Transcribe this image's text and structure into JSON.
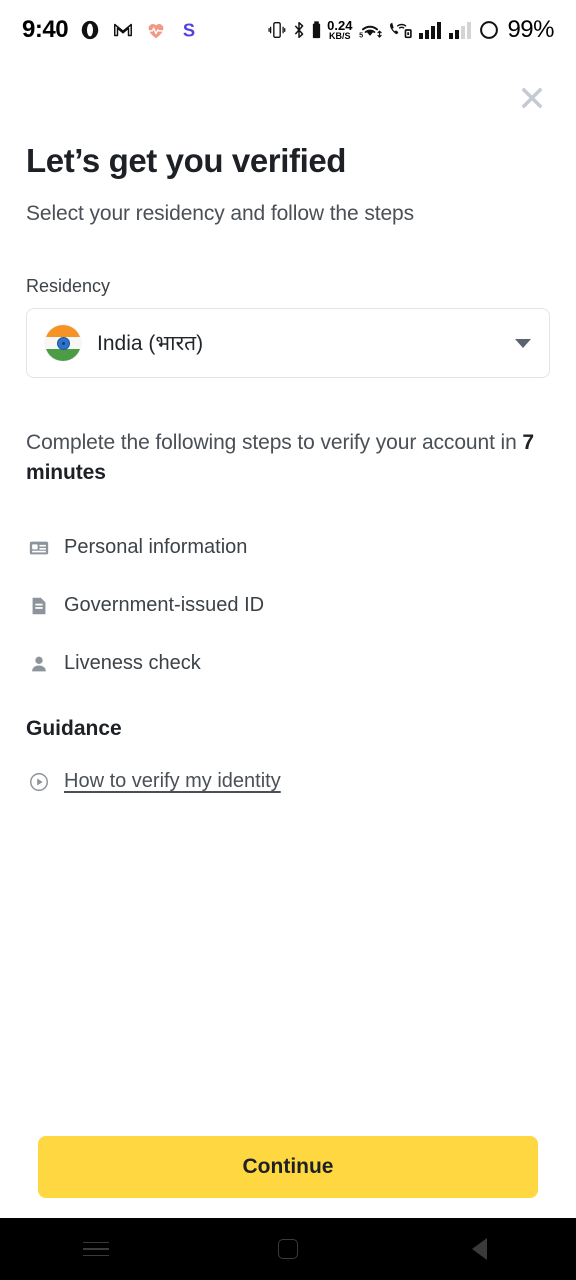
{
  "statusbar": {
    "clock": "9:40",
    "left_icons": [
      "opera-icon",
      "gmail-icon",
      "heart-rate-icon",
      "s-app-icon"
    ],
    "network_speed_value": "0.24",
    "network_speed_unit": "KB/S",
    "network_generation": "5",
    "right_icons": [
      "vibrate-icon",
      "bluetooth-icon",
      "wifi-icon",
      "vowifi-call-icon",
      "signal-bars-sim1-icon",
      "signal-bars-sim2-icon",
      "battery-circle-icon"
    ],
    "battery_percent": "99%"
  },
  "header": {
    "close_icon": "close-icon",
    "title": "Let’s get you verified",
    "subtitle": "Select your residency and follow the steps"
  },
  "residency": {
    "label": "Residency",
    "selected_value": "India (भारत)",
    "flag_icon": "india-flag-icon",
    "caret_icon": "chevron-down-icon"
  },
  "summary": {
    "prefix": "Complete the following steps to verify your account in ",
    "duration": "7 minutes"
  },
  "steps": [
    {
      "icon": "id-card-icon",
      "label": "Personal information"
    },
    {
      "icon": "document-icon",
      "label": "Government-issued ID"
    },
    {
      "icon": "person-icon",
      "label": "Liveness check"
    }
  ],
  "guidance": {
    "heading": "Guidance",
    "link_icon": "play-circle-icon",
    "link_label": "How to verify my identity"
  },
  "cta": {
    "label": "Continue"
  },
  "navbar": {
    "recents_icon": "recents-hamburger-icon",
    "home_icon": "home-square-icon",
    "back_icon": "back-triangle-icon"
  },
  "colors": {
    "accent": "#ffd740",
    "title": "#1d2125",
    "body": "#4a5056",
    "border": "#e2e4e6",
    "icon_gray": "#8d949c",
    "close_gray": "#c3cad1"
  }
}
